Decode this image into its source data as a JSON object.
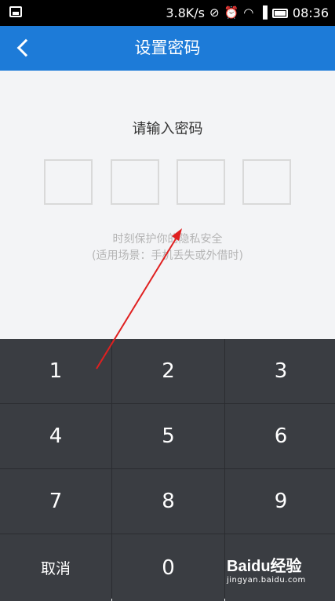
{
  "status_bar": {
    "speed": "3.8K/s",
    "time": "08:36",
    "icons": [
      "image-icon",
      "muted-icon",
      "alarm-icon",
      "wifi-icon",
      "signal-icon",
      "battery-icon"
    ]
  },
  "header": {
    "title": "设置密码",
    "back_icon": "chevron-left-icon",
    "bg_color": "#1d7bd8"
  },
  "content": {
    "prompt": "请输入密码",
    "pin_length": 4,
    "hint_line1": "时刻保护你的隐私安全",
    "hint_line2": "(适用场景：手机丢失或外借时)"
  },
  "keypad": {
    "keys": [
      "1",
      "2",
      "3",
      "4",
      "5",
      "6",
      "7",
      "8",
      "9",
      "取消",
      "0",
      ""
    ]
  },
  "watermark": {
    "logo": "Baidu经验",
    "url": "jingyan.baidu.com"
  }
}
